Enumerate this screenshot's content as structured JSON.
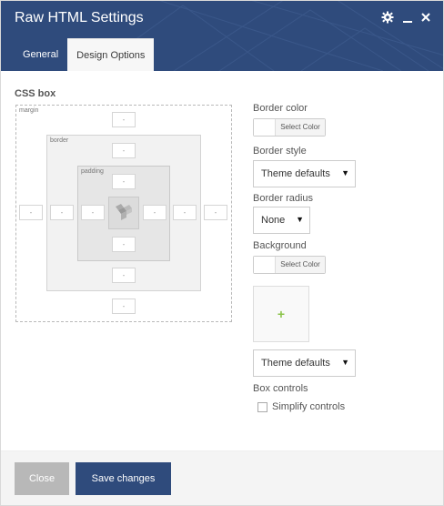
{
  "window": {
    "title": "Raw HTML Settings",
    "icons": [
      "gear-icon",
      "minimize-icon",
      "close-icon"
    ]
  },
  "tabs": [
    {
      "label": "General",
      "active": false
    },
    {
      "label": "Design Options",
      "active": true
    }
  ],
  "css_box": {
    "label": "CSS box",
    "margin_label": "margin",
    "border_label": "border",
    "padding_label": "padding",
    "field_placeholder": "-"
  },
  "options": {
    "border_color_label": "Border color",
    "select_color_label": "Select Color",
    "border_style_label": "Border style",
    "border_style_value": "Theme defaults",
    "border_radius_label": "Border radius",
    "border_radius_value": "None",
    "background_label": "Background",
    "background_add_symbol": "+",
    "background_style_value": "Theme defaults",
    "box_controls_label": "Box controls",
    "simplify_controls_label": "Simplify controls",
    "simplify_checked": false
  },
  "footer": {
    "close_label": "Close",
    "save_label": "Save changes"
  },
  "colors": {
    "header": "#2f4b7c",
    "save_button": "#2f4b7c",
    "close_button": "#b8b8b8",
    "add_icon": "#8bc34a"
  }
}
